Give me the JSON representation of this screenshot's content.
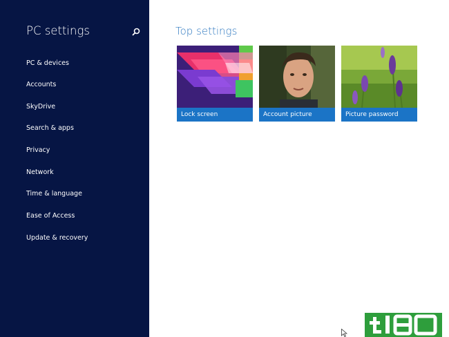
{
  "sidebar": {
    "title": "PC settings",
    "search_icon": "search-icon",
    "items": [
      {
        "label": "PC & devices"
      },
      {
        "label": "Accounts"
      },
      {
        "label": "SkyDrive"
      },
      {
        "label": "Search & apps"
      },
      {
        "label": "Privacy"
      },
      {
        "label": "Network"
      },
      {
        "label": "Time & language"
      },
      {
        "label": "Ease of Access"
      },
      {
        "label": "Update & recovery"
      }
    ]
  },
  "main": {
    "title": "Top settings",
    "tiles": [
      {
        "label": "Lock screen"
      },
      {
        "label": "Account picture"
      },
      {
        "label": "Picture password"
      }
    ]
  },
  "watermark": {
    "text": "tl80"
  },
  "colors": {
    "sidebar_bg": "#061544",
    "accent": "#2e78c0",
    "tile_caption": "#1b74c6",
    "watermark_green": "#2e9e3c"
  }
}
